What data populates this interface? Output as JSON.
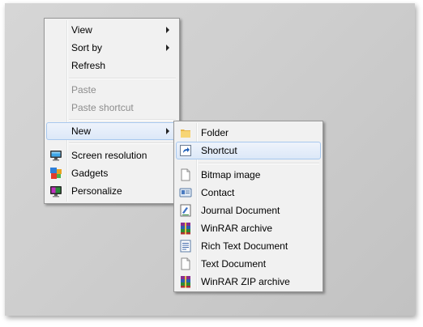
{
  "context_menu": {
    "items": [
      {
        "label": "View",
        "submenu": true
      },
      {
        "label": "Sort by",
        "submenu": true
      },
      {
        "label": "Refresh"
      },
      {
        "label": "Paste",
        "disabled": true
      },
      {
        "label": "Paste shortcut",
        "disabled": true
      },
      {
        "label": "New",
        "submenu": true,
        "highlighted": true
      },
      {
        "label": "Screen resolution",
        "icon": "monitor-icon"
      },
      {
        "label": "Gadgets",
        "icon": "gadgets-icon"
      },
      {
        "label": "Personalize",
        "icon": "personalize-icon"
      }
    ]
  },
  "new_submenu": {
    "items": [
      {
        "label": "Folder",
        "icon": "folder-icon"
      },
      {
        "label": "Shortcut",
        "icon": "shortcut-icon",
        "highlighted": true
      },
      {
        "label": "Bitmap image",
        "icon": "bitmap-icon"
      },
      {
        "label": "Contact",
        "icon": "contact-card-icon"
      },
      {
        "label": "Journal Document",
        "icon": "journal-icon"
      },
      {
        "label": "WinRAR archive",
        "icon": "winrar-icon"
      },
      {
        "label": "Rich Text Document",
        "icon": "rich-text-icon"
      },
      {
        "label": "Text Document",
        "icon": "text-document-icon"
      },
      {
        "label": "WinRAR ZIP archive",
        "icon": "winrar-zip-icon"
      }
    ]
  },
  "colors": {
    "desktop": "#cccccc",
    "menu_background": "#f1f1f1",
    "highlight_border": "#a8c8ee",
    "disabled_text": "#8d8d8d"
  }
}
